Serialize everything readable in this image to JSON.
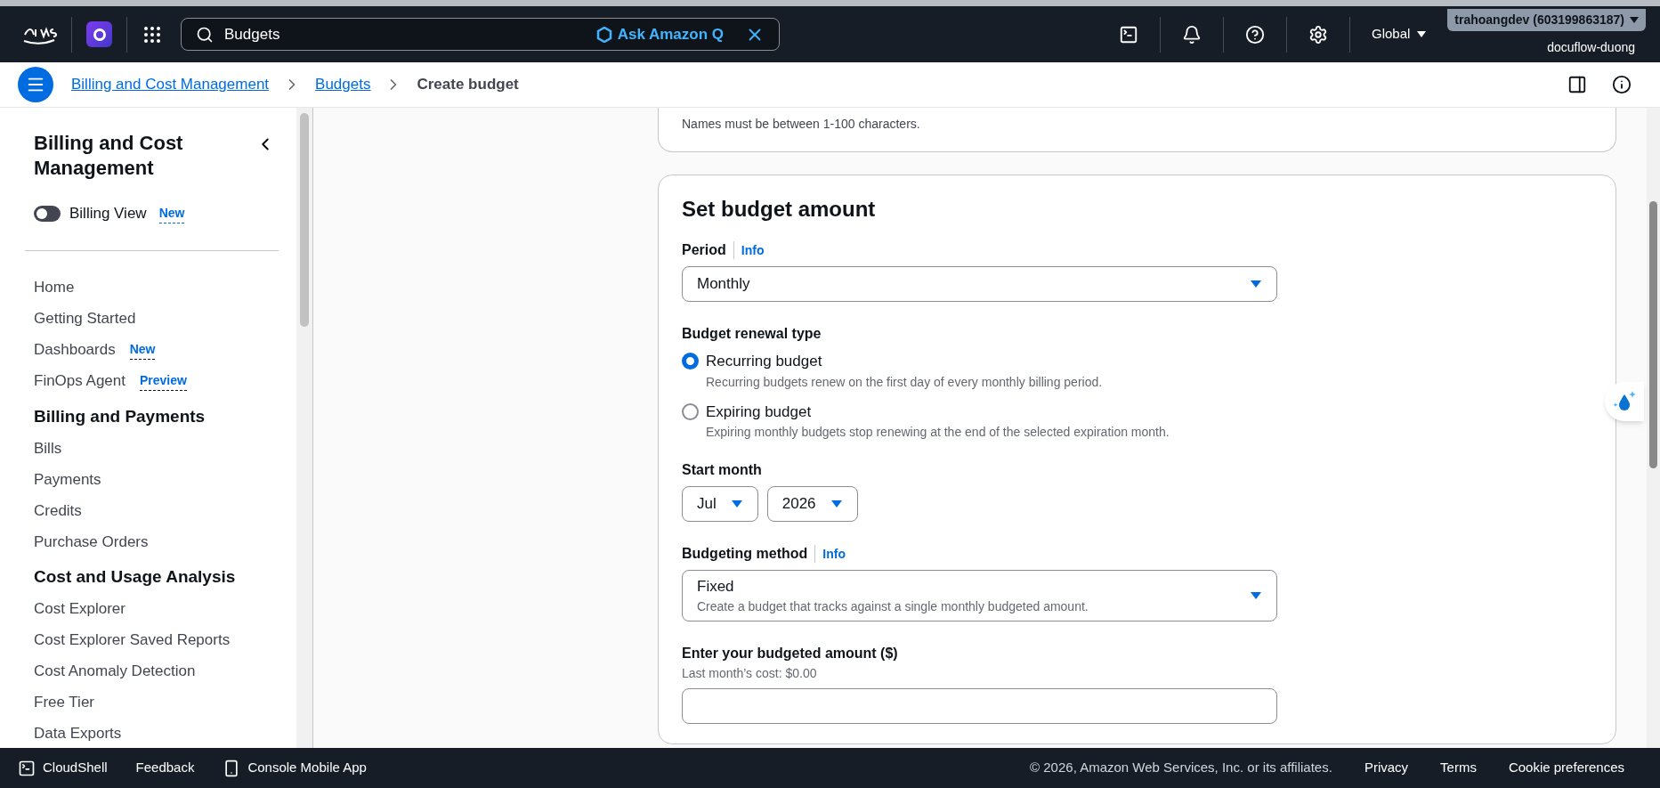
{
  "top_bar": {
    "search": {
      "value": "Budgets"
    },
    "ask_q": "Ask Amazon Q",
    "region": "Global",
    "account": "trahoangdev (603199863187)",
    "user": "docuflow-duong"
  },
  "breadcrumbs": [
    {
      "label": "Billing and Cost Management",
      "link": true
    },
    {
      "label": "Budgets",
      "link": true
    },
    {
      "label": "Create budget",
      "link": false
    }
  ],
  "sidebar": {
    "title": "Billing and Cost Management",
    "toggle": {
      "label": "Billing View",
      "badge": "New",
      "on": false
    },
    "sections": [
      {
        "items": [
          {
            "label": "Home"
          },
          {
            "label": "Getting Started"
          },
          {
            "label": "Dashboards",
            "badge": "New"
          },
          {
            "label": "FinOps Agent",
            "badge": "Preview"
          }
        ]
      },
      {
        "heading": "Billing and Payments",
        "items": [
          {
            "label": "Bills"
          },
          {
            "label": "Payments"
          },
          {
            "label": "Credits"
          },
          {
            "label": "Purchase Orders"
          }
        ]
      },
      {
        "heading": "Cost and Usage Analysis",
        "items": [
          {
            "label": "Cost Explorer"
          },
          {
            "label": "Cost Explorer Saved Reports"
          },
          {
            "label": "Cost Anomaly Detection"
          },
          {
            "label": "Free Tier"
          },
          {
            "label": "Data Exports"
          }
        ]
      }
    ]
  },
  "name_card": {
    "hint": "Names must be between 1-100 characters."
  },
  "amount_card": {
    "title": "Set budget amount",
    "period": {
      "label": "Period",
      "info": "Info",
      "value": "Monthly"
    },
    "renewal": {
      "label": "Budget renewal type",
      "options": [
        {
          "label": "Recurring budget",
          "description": "Recurring budgets renew on the first day of every monthly billing period.",
          "selected": true
        },
        {
          "label": "Expiring budget",
          "description": "Expiring monthly budgets stop renewing at the end of the selected expiration month.",
          "selected": false
        }
      ]
    },
    "start_month": {
      "label": "Start month",
      "month": "Jul",
      "year": "2026"
    },
    "method": {
      "label": "Budgeting method",
      "info": "Info",
      "value": "Fixed",
      "description": "Create a budget that tracks against a single monthly budgeted amount."
    },
    "amount": {
      "label": "Enter your budgeted amount ($)",
      "hint": "Last month’s cost: $0.00"
    }
  },
  "footer": {
    "left": [
      "CloudShell",
      "Feedback",
      "Console Mobile App"
    ],
    "copyright": "© 2026, Amazon Web Services, Inc. or its affiliates.",
    "links": [
      "Privacy",
      "Terms",
      "Cookie preferences"
    ]
  }
}
